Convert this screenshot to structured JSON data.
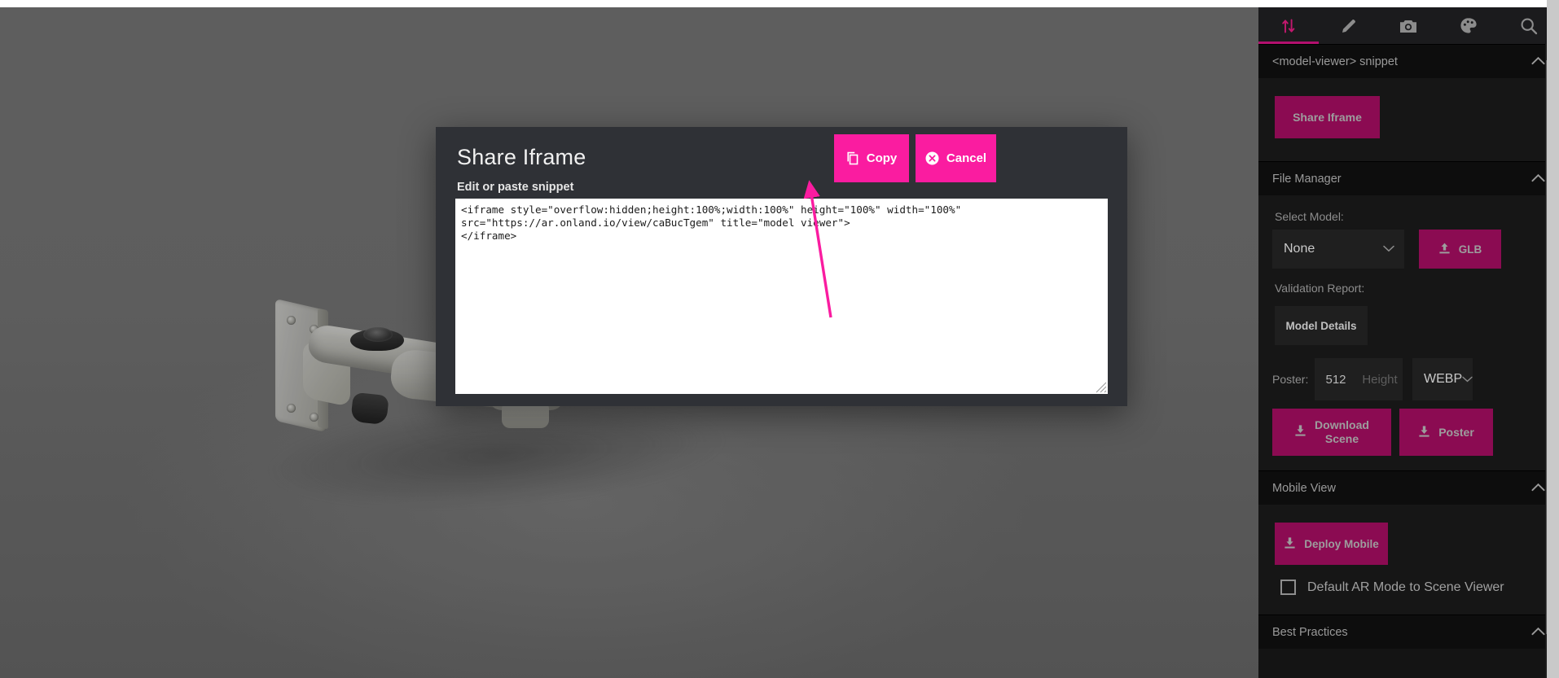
{
  "dialog": {
    "title": "Share Iframe",
    "subtitle": "Edit or paste snippet",
    "copy_label": "Copy",
    "cancel_label": "Cancel",
    "snippet": "<iframe style=\"overflow:hidden;height:100%;width:100%\" height=\"100%\" width=\"100%\"\nsrc=\"https://ar.onland.io/view/caBucTgem\" title=\"model viewer\">\n</iframe>",
    "accent_color": "#FA1CA0",
    "background_color": "#2f3136"
  },
  "sidebar": {
    "tabs": [
      {
        "icon": "import-export-icon",
        "name": "tab-import-export",
        "active": true
      },
      {
        "icon": "pencil-icon",
        "name": "tab-edit",
        "active": false
      },
      {
        "icon": "camera-icon",
        "name": "tab-camera",
        "active": false
      },
      {
        "icon": "palette-icon",
        "name": "tab-materials",
        "active": false
      },
      {
        "icon": "search-icon",
        "name": "tab-inspect",
        "active": false
      }
    ],
    "sections": {
      "snippet": {
        "header": "<model-viewer> snippet",
        "share_iframe_label": "Share Iframe"
      },
      "file_manager": {
        "header": "File Manager",
        "select_model_label": "Select Model:",
        "select_model_value": "None",
        "glb_label": "GLB",
        "validation_report_label": "Validation Report:",
        "model_details_label": "Model Details",
        "poster_label": "Poster:",
        "poster_width_value": "512",
        "poster_height_placeholder": "Height",
        "format_value": "WEBP",
        "download_scene_label": "Download\nScene",
        "download_scene_line1": "Download",
        "download_scene_line2": "Scene",
        "poster_button_label": "Poster"
      },
      "mobile_view": {
        "header": "Mobile View",
        "deploy_mobile_label": "Deploy Mobile",
        "ar_mode_label": "Default AR Mode to Scene Viewer",
        "ar_mode_checked": false
      },
      "best_practices": {
        "header": "Best Practices"
      }
    },
    "accent_color": "#B3106E",
    "button_color": "#8B0B52"
  },
  "viewport": {
    "model_name": "camera-wall-mount-bracket",
    "background_color": "#666666"
  },
  "annotation": {
    "arrow_color": "#FA1CA0",
    "points_to": "copy-button"
  }
}
